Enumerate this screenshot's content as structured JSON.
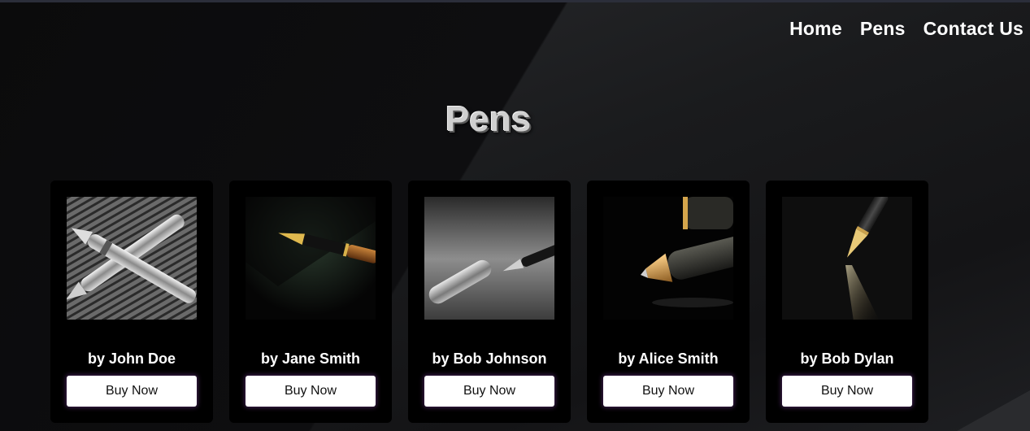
{
  "nav": {
    "items": [
      {
        "label": "Home"
      },
      {
        "label": "Pens"
      },
      {
        "label": "Contact Us"
      }
    ]
  },
  "page": {
    "title": "Pens"
  },
  "products": [
    {
      "author": "by John Doe",
      "button": "Buy Now",
      "image": "crossed-silver-fountain-pens"
    },
    {
      "author": "by Jane Smith",
      "button": "Buy Now",
      "image": "gold-nib-fountain-pen-dark"
    },
    {
      "author": "by Bob Johnson",
      "button": "Buy Now",
      "image": "pen-and-cap-on-desk"
    },
    {
      "author": "by Alice Smith",
      "button": "Buy Now",
      "image": "rollerball-pen-closeup"
    },
    {
      "author": "by Bob Dylan",
      "button": "Buy Now",
      "image": "gold-nib-writing-glow"
    }
  ]
}
